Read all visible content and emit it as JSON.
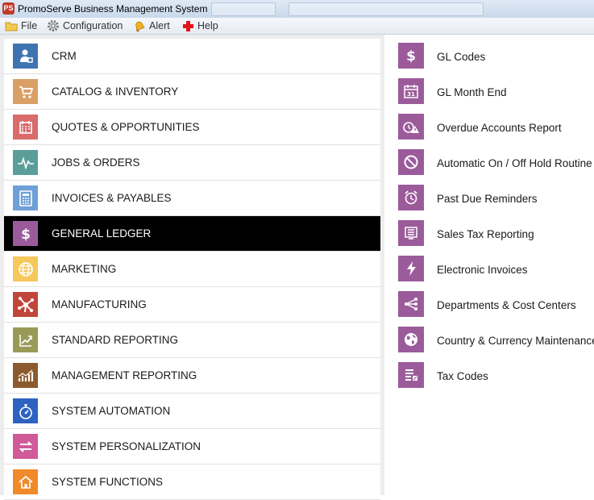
{
  "window": {
    "title": "PromoServe Business Management System",
    "app_icon_glyph": "PS"
  },
  "menu": [
    {
      "label": "File",
      "icon": "folder-icon"
    },
    {
      "label": "Configuration",
      "icon": "gear-icon"
    },
    {
      "label": "Alert",
      "icon": "bell-icon"
    },
    {
      "label": "Help",
      "icon": "red-cross-icon"
    }
  ],
  "categories": [
    {
      "label": "CRM",
      "icon": "contact-person-icon",
      "color": "#3e75b1",
      "selected": false
    },
    {
      "label": "CATALOG & INVENTORY",
      "icon": "shopping-cart-icon",
      "color": "#d9a066",
      "selected": false
    },
    {
      "label": "QUOTES & OPPORTUNITIES",
      "icon": "calendar-icon",
      "color": "#d96b6b",
      "selected": false
    },
    {
      "label": "JOBS & ORDERS",
      "icon": "pulse-icon",
      "color": "#5a9e9a",
      "selected": false
    },
    {
      "label": "INVOICES & PAYABLES",
      "icon": "calculator-icon",
      "color": "#6e9fd8",
      "selected": false
    },
    {
      "label": "GENERAL LEDGER",
      "icon": "dollar-icon",
      "color": "#9b5b9b",
      "selected": true
    },
    {
      "label": "MARKETING",
      "icon": "globe-icon",
      "color": "#f6c75a",
      "selected": false
    },
    {
      "label": "MANUFACTURING",
      "icon": "hub-icon",
      "color": "#c0463a",
      "selected": false
    },
    {
      "label": "STANDARD REPORTING",
      "icon": "chart-up-icon",
      "color": "#9a9a58",
      "selected": false
    },
    {
      "label": "MANAGEMENT REPORTING",
      "icon": "bar-chart-icon",
      "color": "#8c5a2e",
      "selected": false
    },
    {
      "label": "SYSTEM AUTOMATION",
      "icon": "stopwatch-icon",
      "color": "#2d62c1",
      "selected": false
    },
    {
      "label": "SYSTEM PERSONALIZATION",
      "icon": "swap-icon",
      "color": "#d15a98",
      "selected": false
    },
    {
      "label": "SYSTEM FUNCTIONS",
      "icon": "home-icon",
      "color": "#f08a2a",
      "selected": false
    }
  ],
  "submenu": {
    "color": "#9b5b9b",
    "items": [
      {
        "label": "GL Codes",
        "icon": "dollar-icon"
      },
      {
        "label": "GL Month End",
        "icon": "calendar-31-icon",
        "glyph": "31"
      },
      {
        "label": "Overdue Accounts Report",
        "icon": "overdue-alert-icon"
      },
      {
        "label": "Automatic On / Off Hold Routine",
        "icon": "no-entry-icon"
      },
      {
        "label": "Past Due Reminders",
        "icon": "alarm-clock-icon"
      },
      {
        "label": "Sales Tax Reporting",
        "icon": "receipt-icon"
      },
      {
        "label": "Electronic Invoices",
        "icon": "lightning-icon"
      },
      {
        "label": "Departments & Cost Centers",
        "icon": "share-branches-icon"
      },
      {
        "label": "Country & Currency Maintenance",
        "icon": "world-icon"
      },
      {
        "label": "Tax Codes",
        "icon": "tax-table-icon"
      }
    ]
  }
}
